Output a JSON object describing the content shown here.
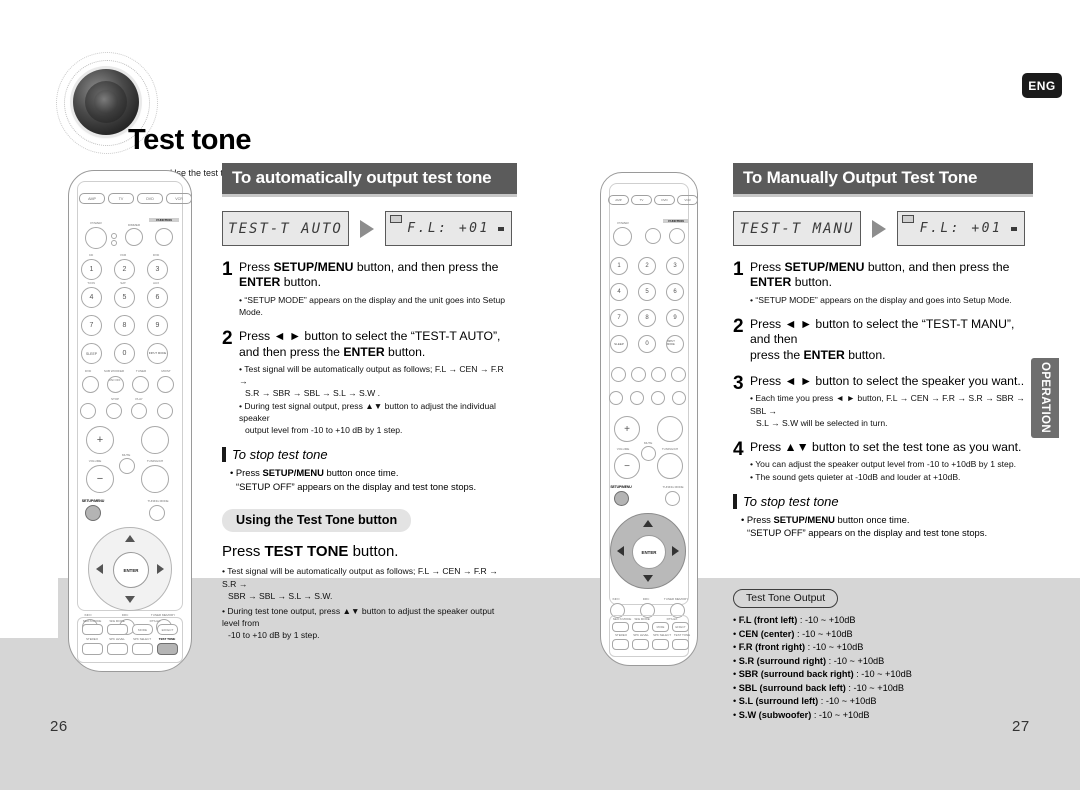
{
  "header": {
    "title": "Test tone",
    "subtitle": "Use the test tone check the speaker connection status or level.",
    "lang_badge": "ENG"
  },
  "side_tab": {
    "label": "OPERATION"
  },
  "pages": {
    "left": "26",
    "right": "27"
  },
  "left_column": {
    "banner": "To automatically output test tone",
    "lcd": {
      "left_display": "TEST-T AUTO",
      "right_display": "F.L: +01"
    },
    "steps": [
      {
        "num": "1",
        "main_pre": "Press ",
        "main_b1": "SETUP/MENU",
        "main_mid": " button, and then press the ",
        "main_b2": "ENTER",
        "main_post": " button.",
        "bullets": [
          "• “SETUP MODE” appears on the display and the unit goes into Setup Mode."
        ]
      },
      {
        "num": "2",
        "main_pre": "Press ◄ ► button to select the “TEST-T AUTO”,",
        "main_b1": "",
        "main_mid": "and then press the ",
        "main_b2": "ENTER",
        "main_post": " button.",
        "bullets": [
          "• Test signal will be automatically output as follows; F.L → CEN → F.R →",
          "S.R → SBR → SBL → S.L → S.W .",
          "• During test signal output, press ▲▼ button to adjust the individual speaker",
          "output level from -10 to +10 dB by 1 step."
        ]
      }
    ],
    "stop": {
      "title": "To stop test tone",
      "line1_pre": "• Press ",
      "line1_b": "SETUP/MENU",
      "line1_post": " button once time.",
      "line2": "“SETUP OFF” appears on the display and test tone stops."
    },
    "pill": "Using the Test Tone button",
    "press_pre": "Press ",
    "press_b": "TEST TONE",
    "press_post": " button.",
    "press_bullets": [
      "• Test signal will be automatically output as follows; F.L → CEN → F.R → S.R →",
      "SBR → SBL → S.L → S.W.",
      "• During test tone output, press ▲▼ button to adjust the speaker output level from",
      "-10 to +10 dB by 1 step."
    ]
  },
  "right_column": {
    "banner": "To Manually Output Test Tone",
    "lcd": {
      "left_display": "TEST-T MANU",
      "right_display": "F.L: +01"
    },
    "steps": [
      {
        "num": "1",
        "main_pre": "Press ",
        "main_b1": "SETUP/MENU",
        "main_mid": " button, and then press the ",
        "main_b2": "ENTER",
        "main_post": " button.",
        "bullets": [
          "• “SETUP MODE” appears on the display and goes into Setup Mode."
        ]
      },
      {
        "num": "2",
        "main_pre": "Press ◄ ► button to select the “TEST-T MANU”, and then",
        "main_b1": "",
        "main_mid": "press the ",
        "main_b2": "ENTER",
        "main_post": " button.",
        "bullets": []
      },
      {
        "num": "3",
        "main_pre": "Press ◄ ► button to select the speaker you want..",
        "main_b1": "",
        "main_mid": "",
        "main_b2": "",
        "main_post": "",
        "bullets": [
          "• Each time you press ◄ ► button, F.L → CEN → F.R → S.R → SBR → SBL →",
          "S.L → S.W will be selected in turn."
        ]
      },
      {
        "num": "4",
        "main_pre": "Press ▲▼ button to set the test tone as you want.",
        "main_b1": "",
        "main_mid": "",
        "main_b2": "",
        "main_post": "",
        "bullets": [
          "• You can adjust the speaker output level from -10 to +10dB by 1 step.",
          "• The sound gets quieter at -10dB and louder at +10dB."
        ]
      }
    ],
    "stop": {
      "title": "To stop test tone",
      "line1_pre": "• Press ",
      "line1_b": "SETUP/MENU",
      "line1_post": " button once time.",
      "line2": "“SETUP OFF” appears on the display and test tone stops."
    }
  },
  "test_tone_output": {
    "title": "Test Tone Output",
    "items": [
      {
        "label": "F.L (front left)",
        "value": " : -10 ~ +10dB"
      },
      {
        "label": "CEN (center)",
        "value": " : -10 ~ +10dB"
      },
      {
        "label": "F.R (front right)",
        "value": " : -10 ~ +10dB"
      },
      {
        "label": "S.R (surround right)",
        "value": " : -10 ~ +10dB"
      },
      {
        "label": "SBR (surround back right)",
        "value": " : -10 ~ +10dB"
      },
      {
        "label": "SBL (surround back left)",
        "value": " : -10 ~ +10dB"
      },
      {
        "label": "S.L (surround left)",
        "value": " : -10 ~ +10dB"
      },
      {
        "label": "S.W (subwoofer)",
        "value": " : -10 ~ +10dB"
      }
    ]
  },
  "remote": {
    "devices": [
      "AMP",
      "TV",
      "DVD",
      "VCR"
    ],
    "power_label": "POWER",
    "dimmer_label": "DIMMER",
    "function_label": "FUNCTION",
    "numbers": [
      {
        "key": "1",
        "top": "CD"
      },
      {
        "key": "2",
        "top": "VCR"
      },
      {
        "key": "3",
        "top": "DVD"
      },
      {
        "key": "4",
        "top": "T.ION"
      },
      {
        "key": "5",
        "top": "SAT"
      },
      {
        "key": "6",
        "top": "AUX"
      },
      {
        "key": "7",
        "top": ""
      },
      {
        "key": "8",
        "top": ""
      },
      {
        "key": "9",
        "top": ""
      },
      {
        "key": "0",
        "top": ""
      }
    ],
    "sleep_label": "SLEEP",
    "input_mode_label": "INPUT MODE",
    "row_labels": [
      "DVD",
      "SUB WOOFER",
      "TUNER",
      "MO/ST"
    ],
    "onoff_label": "ON/ OFF",
    "transport": [
      "STOP",
      "PLAY"
    ],
    "volume_label": "VOLUME",
    "mute_label": "MUTE",
    "tuning_label": "TUNING/CH",
    "setup_menu_label": "SETUP/MENU",
    "tuning_mode_label": "TUNING MODE",
    "enter_label": "ENTER",
    "bottom_row1": [
      "INFO",
      "DRC",
      "TUNER MEMORY"
    ],
    "bottom_row2": [
      "NEO:6 MODE",
      "SFE MODE",
      "DTS-EX"
    ],
    "bottom_row3": [
      "MODE",
      "EFFECT"
    ],
    "bottom_row4": [
      "STEREO",
      "SPK LEVEL",
      "SPK SELECT",
      "TEST TONE"
    ]
  }
}
